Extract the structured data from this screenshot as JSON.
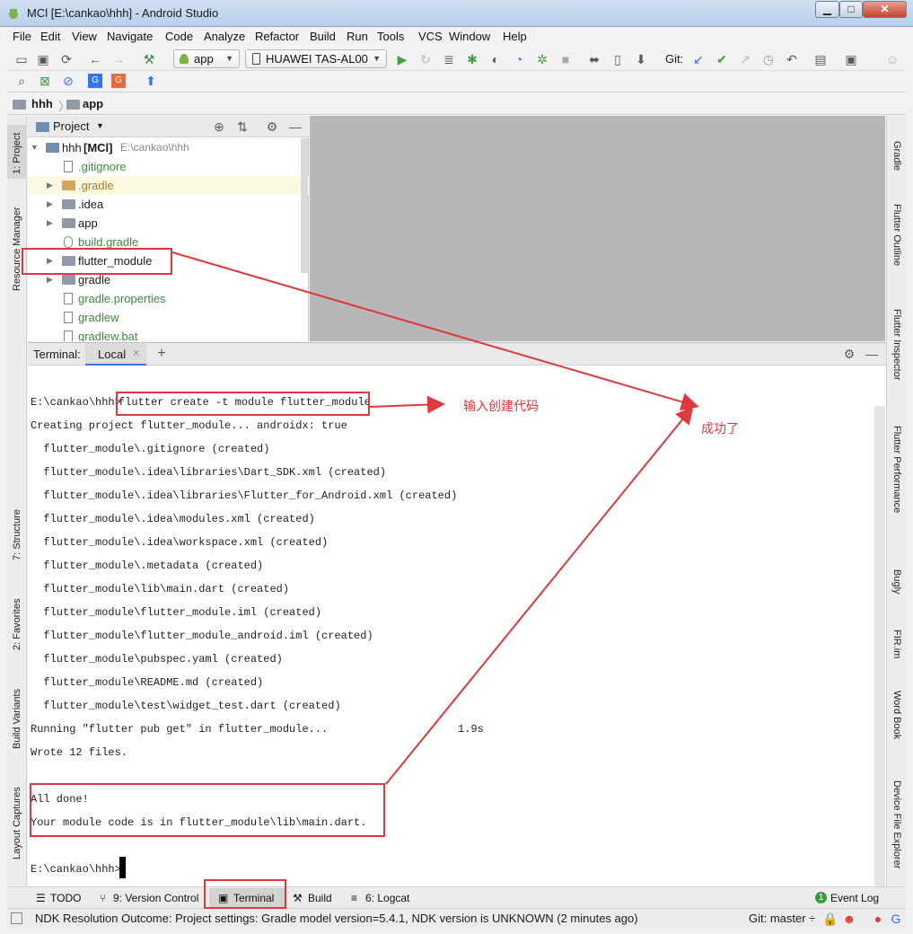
{
  "window": {
    "title": "MCl [E:\\cankao\\hhh] - Android Studio",
    "min": "▁",
    "max": "□",
    "close": "✕"
  },
  "menu": [
    "File",
    "Edit",
    "View",
    "Navigate",
    "Code",
    "Analyze",
    "Refactor",
    "Build",
    "Run",
    "Tools",
    "VCS",
    "Window",
    "Help"
  ],
  "toolbar": {
    "run_config": "app",
    "device": "HUAWEI TAS-AL00",
    "git_label": "Git:"
  },
  "breadcrumb": {
    "project": "hhh",
    "module": "app"
  },
  "project_panel": {
    "title": "Project"
  },
  "tree": {
    "root": {
      "name": "hhh",
      "tag": "[MCl]",
      "path": "E:\\cankao\\hhh"
    },
    "items": [
      ".gitignore",
      ".gradle",
      ".idea",
      "app",
      "build.gradle",
      "flutter_module",
      "gradle",
      "gradle.properties",
      "gradlew",
      "gradlew.bat"
    ]
  },
  "left_tabs": [
    "1: Project",
    "Resource Manager",
    "7: Structure",
    "2: Favorites",
    "Build Variants",
    "Layout Captures"
  ],
  "right_tabs": [
    "Gradle",
    "Flutter Outline",
    "Flutter Inspector",
    "Flutter Performance",
    "Bugly",
    "FIR.im",
    "Word Book",
    "Device File Explorer"
  ],
  "terminal": {
    "label": "Terminal:",
    "tab": "Local",
    "prompt": "E:\\cankao\\hhh>",
    "command": "flutter create -t module flutter_module",
    "lines": [
      "Creating project flutter_module... androidx: true",
      "  flutter_module\\.gitignore (created)",
      "  flutter_module\\.idea\\libraries\\Dart_SDK.xml (created)",
      "  flutter_module\\.idea\\libraries\\Flutter_for_Android.xml (created)",
      "  flutter_module\\.idea\\modules.xml (created)",
      "  flutter_module\\.idea\\workspace.xml (created)",
      "  flutter_module\\.metadata (created)",
      "  flutter_module\\lib\\main.dart (created)",
      "  flutter_module\\flutter_module.iml (created)",
      "  flutter_module\\flutter_module_android.iml (created)",
      "  flutter_module\\pubspec.yaml (created)",
      "  flutter_module\\README.md (created)",
      "  flutter_module\\test\\widget_test.dart (created)"
    ],
    "pub_get": "Running \"flutter pub get\" in flutter_module...",
    "pub_time": "1.9s",
    "wrote": "Wrote 12 files.",
    "done": "All done!",
    "module_code": "Your module code is in flutter_module\\lib\\main.dart.",
    "final_prompt": "E:\\cankao\\hhh>"
  },
  "annotations": {
    "input_code": "输入创建代码",
    "success": "成功了"
  },
  "bottom_tabs": {
    "todo": "TODO",
    "version_control": "9: Version Control",
    "terminal": "Terminal",
    "build": "Build",
    "logcat": "6: Logcat",
    "event_log": "Event Log",
    "event_count": "1"
  },
  "status": {
    "message": "NDK Resolution Outcome: Project settings: Gradle model version=5.4.1, NDK version is UNKNOWN (2 minutes ago)",
    "git_branch": "Git: master ÷"
  },
  "colors": {
    "annotation": "#e0393b",
    "accent": "#3574f0",
    "git_green": "#389e3d"
  }
}
